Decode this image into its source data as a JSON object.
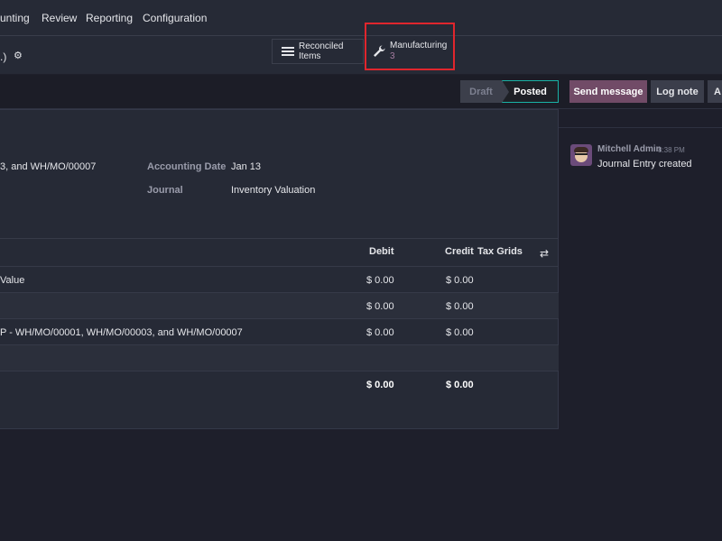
{
  "menu": [
    "unting",
    "Review",
    "Reporting",
    "Configuration"
  ],
  "breadcrumb": ".)",
  "smart_buttons": {
    "reconciled": "Reconciled Items",
    "manufacturing": "Manufacturing",
    "manufacturing_count": "3"
  },
  "status": [
    "Draft",
    "Posted"
  ],
  "actions": [
    "Send message",
    "Log note",
    "A"
  ],
  "form": {
    "ref_partial": "3, and WH/MO/00007",
    "accounting_date_label": "Accounting Date",
    "accounting_date": "Jan 13",
    "journal_label": "Journal",
    "journal": "Inventory Valuation"
  },
  "table": {
    "headers": [
      "Debit",
      "Credit",
      "Tax Grids"
    ],
    "rows": [
      {
        "label": "Value",
        "debit": "$ 0.00",
        "credit": "$ 0.00"
      },
      {
        "label": "",
        "debit": "$ 0.00",
        "credit": "$ 0.00"
      },
      {
        "label": "P - WH/MO/00001, WH/MO/00003, and WH/MO/00007",
        "debit": "$ 0.00",
        "credit": "$ 0.00"
      }
    ],
    "total_debit": "$ 0.00",
    "total_credit": "$ 0.00"
  },
  "chatter": {
    "author": "Mitchell Admin",
    "time": "8:38 PM",
    "message": "Journal Entry created"
  },
  "colors": {
    "accent": "#714b67",
    "posted_border": "#1ab3a6",
    "highlight": "#e0262d"
  }
}
